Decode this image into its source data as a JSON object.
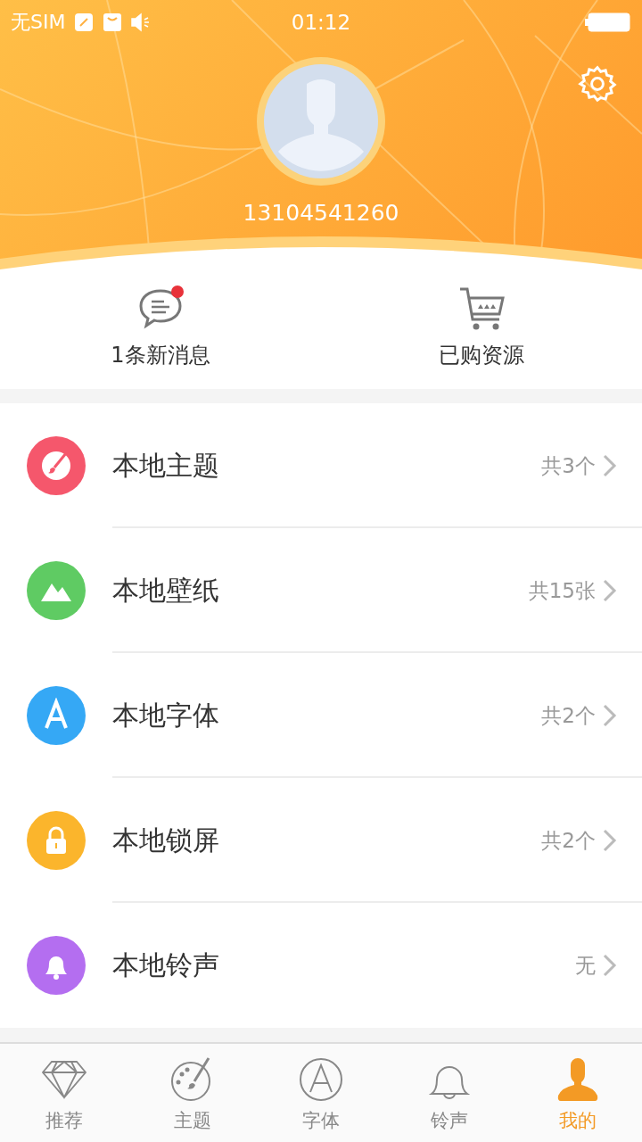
{
  "status_bar": {
    "carrier": "无SIM",
    "time": "01:12"
  },
  "profile": {
    "phone": "13104541260"
  },
  "quick_actions": [
    {
      "kind": "message",
      "label": "1条新消息",
      "unread": true
    },
    {
      "kind": "cart",
      "label": "已购资源",
      "unread": false
    }
  ],
  "menu": [
    {
      "kind": "theme",
      "label": "本地主题",
      "count": "共3个",
      "color": "#f5576c"
    },
    {
      "kind": "wallpaper",
      "label": "本地壁纸",
      "count": "共15张",
      "color": "#5fcb63"
    },
    {
      "kind": "font",
      "label": "本地字体",
      "count": "共2个",
      "color": "#35a8f5"
    },
    {
      "kind": "lock",
      "label": "本地锁屏",
      "count": "共2个",
      "color": "#fbb52c"
    },
    {
      "kind": "ringtone",
      "label": "本地铃声",
      "count": "无",
      "color": "#b46ef0"
    }
  ],
  "tabs": [
    {
      "kind": "diamond",
      "label": "推荐",
      "selected": false
    },
    {
      "kind": "palette",
      "label": "主题",
      "selected": false
    },
    {
      "kind": "font",
      "label": "字体",
      "selected": false
    },
    {
      "kind": "bell",
      "label": "铃声",
      "selected": false
    },
    {
      "kind": "person",
      "label": "我的",
      "selected": true
    }
  ]
}
